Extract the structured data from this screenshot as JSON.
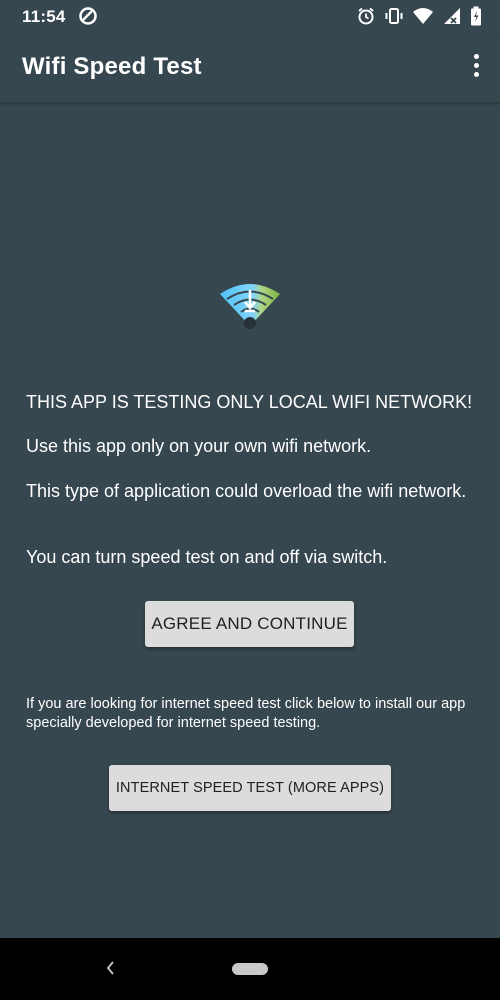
{
  "status_bar": {
    "time": "11:54",
    "left_icon": "sync-circle-icon",
    "right_icons": [
      "alarm-icon",
      "vibrate-icon",
      "wifi-icon",
      "signal-icon",
      "battery-icon"
    ]
  },
  "app_bar": {
    "title": "Wifi Speed Test",
    "menu_icon": "more-vert-icon"
  },
  "main": {
    "logo_icon": "wifi-download-icon",
    "message_1": "THIS APP IS TESTING ONLY LOCAL WIFI NETWORK!",
    "message_2": "Use this app only on your own wifi network.",
    "message_3": "This type of application could overload the wifi network.",
    "message_4": "You can turn speed test on and off via switch.",
    "agree_button": "AGREE AND CONTINUE",
    "note": "If you are looking for internet speed test click below to install our app specially developed for internet speed testing.",
    "internet_button": "INTERNET SPEED TEST (MORE APPS)"
  },
  "nav_bar": {
    "back_icon": "back-icon",
    "home_icon": "home-pill-icon"
  },
  "colors": {
    "background": "#37474f",
    "button": "#dcdcdc",
    "button_text": "#212121",
    "nav_bar": "#000000"
  }
}
